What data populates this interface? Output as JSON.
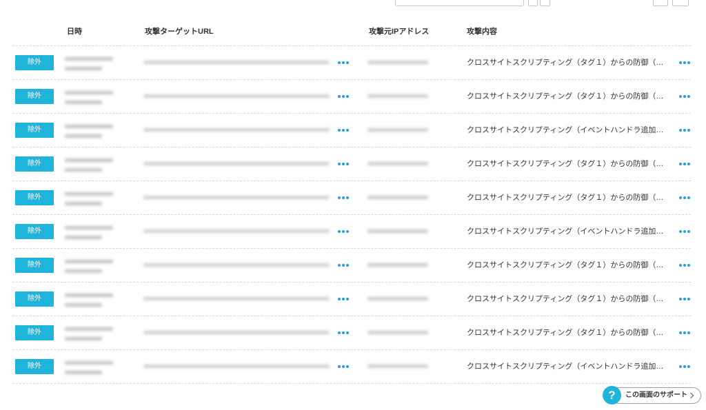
{
  "colors": {
    "accent": "#1fb4d9",
    "more_icon": "#2a9ed6",
    "text": "#333333",
    "separator": "#d6d6d6",
    "redacted": "#c2c2c2"
  },
  "icons": {
    "row_more": "more-icon",
    "help": "help-icon",
    "support_chevron": "chevron-right-icon"
  },
  "table": {
    "headers": {
      "date": "日時",
      "target_url": "攻撃ターゲットURL",
      "source_ip": "攻撃元IPアドレス",
      "attack_content": "攻撃内容"
    },
    "rows": [
      {
        "exclude_label": "除外",
        "attack_content": "クロスサイトスクリプティング（タグ１）からの防御（…"
      },
      {
        "exclude_label": "除外",
        "attack_content": "クロスサイトスクリプティング（タグ１）からの防御（…"
      },
      {
        "exclude_label": "除外",
        "attack_content": "クロスサイトスクリプティング（イベントハンドラ追加…"
      },
      {
        "exclude_label": "除外",
        "attack_content": "クロスサイトスクリプティング（タグ１）からの防御（…"
      },
      {
        "exclude_label": "除外",
        "attack_content": "クロスサイトスクリプティング（タグ１）からの防御（…"
      },
      {
        "exclude_label": "除外",
        "attack_content": "クロスサイトスクリプティング（イベントハンドラ追加…"
      },
      {
        "exclude_label": "除外",
        "attack_content": "クロスサイトスクリプティング（タグ１）からの防御（…"
      },
      {
        "exclude_label": "除外",
        "attack_content": "クロスサイトスクリプティング（タグ１）からの防御（…"
      },
      {
        "exclude_label": "除外",
        "attack_content": "クロスサイトスクリプティング（タグ１）からの防御（…"
      },
      {
        "exclude_label": "除外",
        "attack_content": "クロスサイトスクリプティング（イベントハンドラ追加…"
      }
    ]
  },
  "support": {
    "icon_text": "?",
    "label": "この画面のサポート"
  }
}
